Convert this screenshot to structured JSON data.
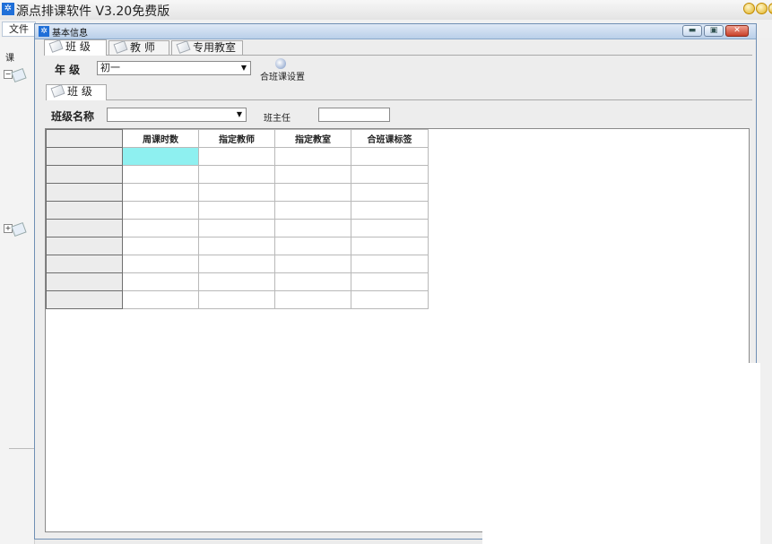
{
  "app": {
    "title": "源点排课软件 V3.20免费版",
    "logo_icon": "app-logo-icon",
    "accent": "#1f6fd8"
  },
  "menubar": {
    "file": "文件"
  },
  "child_window": {
    "title": "基本信息",
    "controls": [
      "minimize",
      "restore",
      "close"
    ]
  },
  "tabs": [
    {
      "label": "班 级",
      "active": true
    },
    {
      "label": "教 师",
      "active": false
    },
    {
      "label": "专用教室",
      "active": false
    }
  ],
  "grade": {
    "label": "年 级",
    "value": "初一"
  },
  "merge_button": {
    "label": "合班课设置",
    "icon": "merge-class-icon"
  },
  "subtab": {
    "label": "班 级"
  },
  "class_form": {
    "name_label": "班级名称",
    "name_value": "",
    "teacher_label": "班主任",
    "teacher_value": ""
  },
  "grid": {
    "columns": [
      "周课时数",
      "指定教师",
      "指定教室",
      "合班课标签"
    ],
    "row_count": 9,
    "selected_cell_color": "#8ef0f0"
  },
  "left_panel": {
    "stub_label": "课"
  }
}
